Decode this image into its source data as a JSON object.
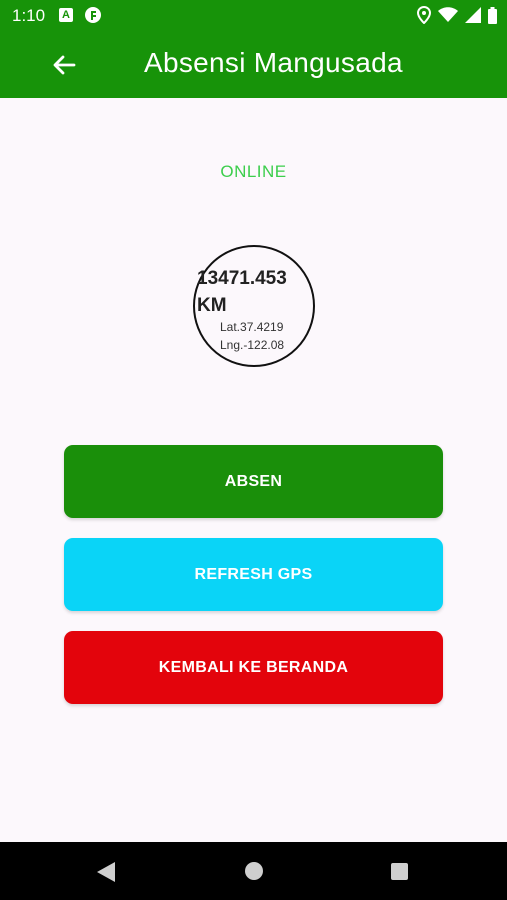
{
  "status_bar": {
    "time": "1:10",
    "left_icons": [
      "a-notification-icon",
      "f-notification-icon"
    ],
    "right_icons": [
      "location-icon",
      "wifi-icon",
      "signal-icon",
      "battery-icon"
    ]
  },
  "app_bar": {
    "title": "Absensi Mangusada",
    "back_icon": "arrow-left-icon"
  },
  "connection_status": "ONLINE",
  "distance": {
    "value": "13471.453 KM",
    "latitude": "Lat.37.4219",
    "longitude": "Lng.-122.08"
  },
  "buttons": {
    "absen": "ABSEN",
    "refresh_gps": "REFRESH GPS",
    "back_home": "KEMBALI KE BERANDA"
  },
  "colors": {
    "app_bar": "#179309",
    "online": "#3cce4c",
    "absen": "#1a8f0a",
    "refresh": "#0ad4f7",
    "back_home": "#e3040c"
  },
  "nav_bar": {
    "icons": [
      "back-triangle-icon",
      "home-circle-icon",
      "recents-square-icon"
    ]
  }
}
